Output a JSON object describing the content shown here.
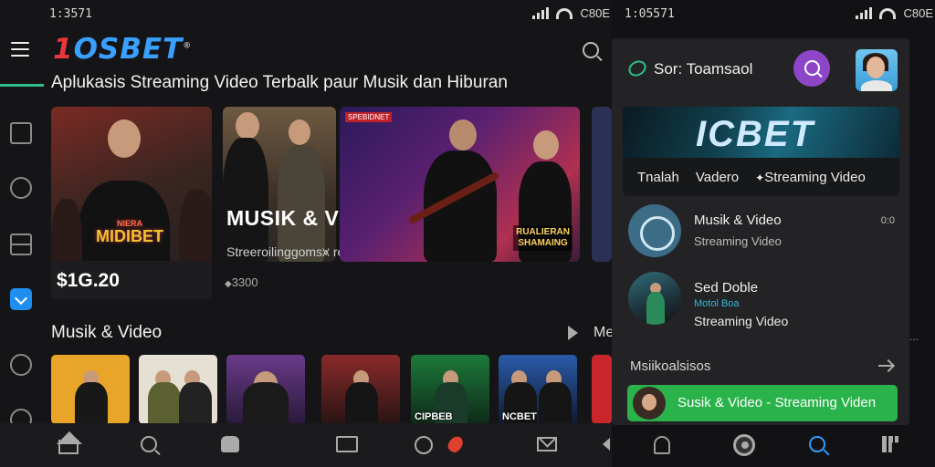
{
  "left_screen": {
    "status": {
      "time": "1:3571",
      "battery": "C80E"
    },
    "app": {
      "logo_mark": "1",
      "logo_text": "OSBET",
      "logo_sup": "®"
    },
    "subtitle": "Aplukasis Streaming Video Terbalk paur Musik dan Hiburan",
    "hero_cards": [
      {
        "stamp_small": "NIERA",
        "stamp": "MIDIBET",
        "price": "$1G.20"
      },
      {
        "title": "MUSIK & VIDEO",
        "subtitle": "Streeroilinggoms⩙ rean",
        "views": "3300"
      },
      {
        "tag": "SPEBIDNET",
        "poster_line1": "RUALIERAN",
        "poster_line2": "SHAMAING"
      }
    ],
    "section": {
      "title": "Musik & Video",
      "more": "Me"
    },
    "thumbs": [
      {
        "caption": ""
      },
      {
        "caption": ""
      },
      {
        "caption": ""
      },
      {
        "caption": ""
      },
      {
        "caption": "CIPBEB"
      },
      {
        "caption": "NCBET"
      },
      {
        "caption": ""
      }
    ],
    "nav": [
      "home-icon",
      "search-icon",
      "bag-icon",
      "tv-icon",
      "globe-icon",
      "fire-icon",
      "mail-icon",
      "back-icon"
    ]
  },
  "right_screen": {
    "status": {
      "time": "1:05571",
      "battery": "C80E"
    },
    "header": {
      "title": "Sor: Toamsaol"
    },
    "banner": {
      "big": "ICBET",
      "chips": [
        "Tnalah",
        "Vadero",
        "Streaming Video"
      ]
    },
    "list": [
      {
        "title": "Musik & Video",
        "subtitle": "Streaming Video",
        "duration": "0:0"
      },
      {
        "title": "Sed Doble",
        "highlight": "Motol Boa",
        "subtitle": "Streaming Video"
      }
    ],
    "section_label": "Msiikoalsisos",
    "dots": "...",
    "now_playing": "Susik & Video  -  Streaming Viden",
    "colors": {
      "accent_green": "#2ab34a",
      "accent_purple": "#8e46c8",
      "accent_blue": "#2e9cff"
    }
  }
}
